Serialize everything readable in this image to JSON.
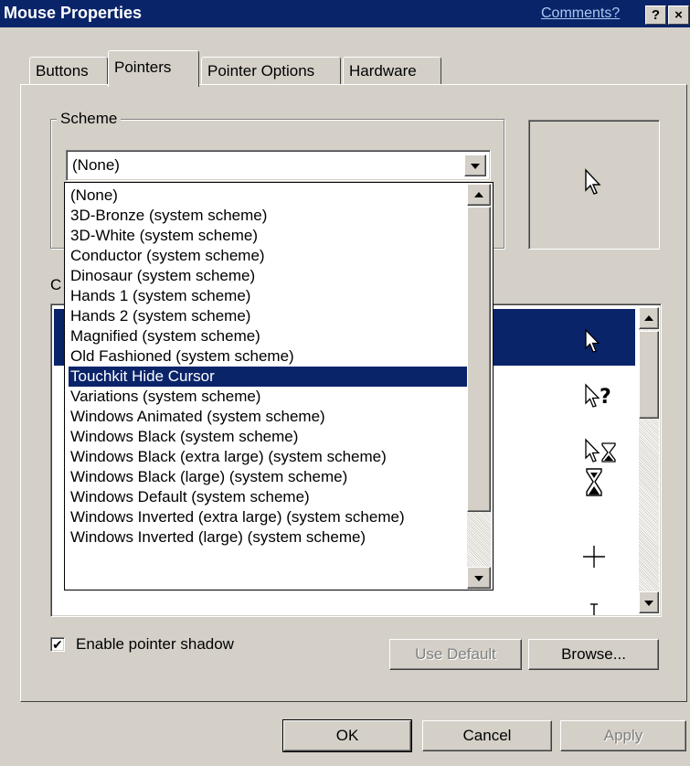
{
  "window": {
    "title": "Mouse Properties",
    "comments_link": "Comments?",
    "help_button": "?",
    "close_button": "×"
  },
  "tabs": [
    {
      "label": "Buttons",
      "active": false
    },
    {
      "label": "Pointers",
      "active": true
    },
    {
      "label": "Pointer Options",
      "active": false
    },
    {
      "label": "Hardware",
      "active": false
    }
  ],
  "scheme": {
    "group_label": "Scheme",
    "selected_value": "(None)",
    "options": [
      "(None)",
      "3D-Bronze (system scheme)",
      "3D-White (system scheme)",
      "Conductor (system scheme)",
      "Dinosaur (system scheme)",
      "Hands 1 (system scheme)",
      "Hands 2 (system scheme)",
      "Magnified (system scheme)",
      "Old Fashioned (system scheme)",
      "Touchkit Hide Cursor",
      "Variations (system scheme)",
      "Windows Animated (system scheme)",
      "Windows Black  (system scheme)",
      "Windows Black (extra large) (system scheme)",
      "Windows Black (large) (system scheme)",
      "Windows Default (system scheme)",
      "Windows Inverted (extra large) (system scheme)",
      "Windows Inverted (large) (system scheme)"
    ],
    "highlighted_option": "Touchkit Hide Cursor"
  },
  "preview": {
    "icon": "arrow-pointer-icon"
  },
  "customize": {
    "label_partial": "C",
    "cursor_icons": [
      "arrow-pointer-icon",
      "help-select-icon",
      "working-in-background-icon",
      "busy-hourglass-icon",
      "precision-select-icon",
      "text-select-icon"
    ]
  },
  "controls": {
    "enable_shadow_label": "Enable pointer shadow",
    "enable_shadow_checked": true,
    "use_default_label": "Use Default",
    "browse_label": "Browse..."
  },
  "dialog_buttons": {
    "ok": "OK",
    "cancel": "Cancel",
    "apply": "Apply"
  },
  "colors": {
    "titlebar": "#0a246a",
    "selection": "#0a246a",
    "face": "#d4d0c8"
  }
}
